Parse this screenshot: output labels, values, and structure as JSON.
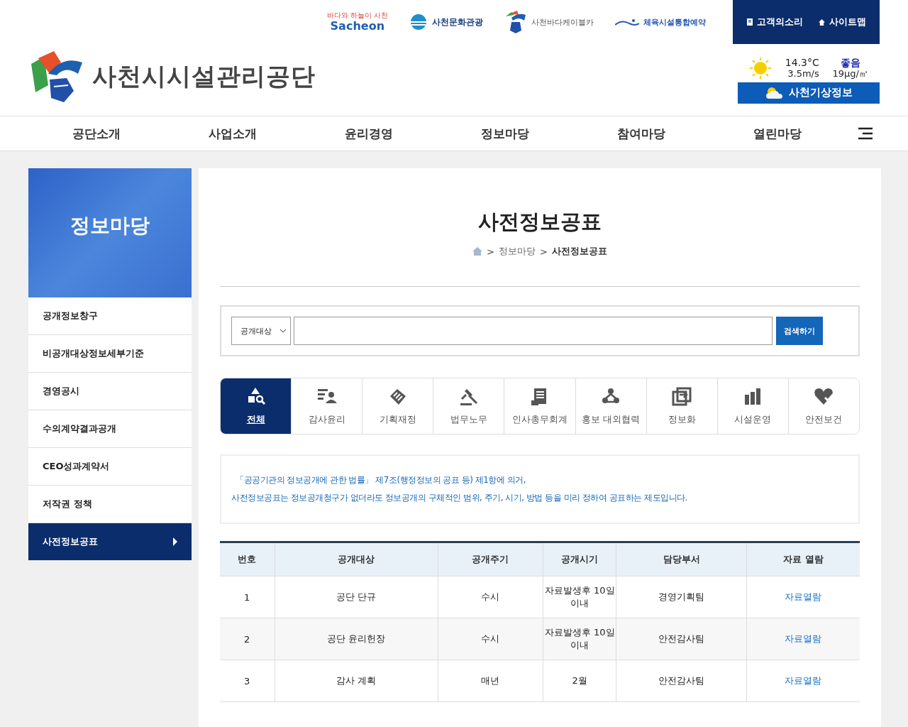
{
  "top_links": [
    {
      "kind": "sacheon",
      "label": "Sacheon",
      "tagline": "바다와 하늘이 사천"
    },
    {
      "kind": "culture",
      "label": "사천문화관광"
    },
    {
      "kind": "cable",
      "label": "사천바다케이블카"
    },
    {
      "kind": "sports",
      "label": "체육시설통합예약"
    }
  ],
  "util_links": [
    {
      "kind": "voice",
      "label": "고객의소리"
    },
    {
      "kind": "home",
      "label": "사이트맵"
    }
  ],
  "logo": {
    "text": "사천시시설관리공단"
  },
  "weather": {
    "temperature": "14.3°C",
    "wind": "3.5m/s",
    "air_status": "좋음",
    "pm": "19μg/㎥",
    "button": "사천기상정보"
  },
  "nav": [
    "공단소개",
    "사업소개",
    "윤리경영",
    "정보마당",
    "참여마당",
    "열린마당"
  ],
  "sidebar": {
    "title": "정보마당",
    "items": [
      {
        "label": "공개정보창구",
        "selected": false
      },
      {
        "label": "비공개대상정보세부기준",
        "selected": false
      },
      {
        "label": "경영공시",
        "selected": false
      },
      {
        "label": "수의계약결과공개",
        "selected": false
      },
      {
        "label": "CEO성과계약서",
        "selected": false
      },
      {
        "label": "저작권 정책",
        "selected": false
      },
      {
        "label": "사전정보공표",
        "selected": true
      }
    ]
  },
  "page_title": "사전정보공표",
  "breadcrumb": [
    "정보마당",
    "사전정보공표"
  ],
  "breadcrumb_separator": ">",
  "search": {
    "select_value": "공개대상",
    "button": "검색하기"
  },
  "categories": [
    {
      "kind": "all",
      "label": "전체",
      "selected": true
    },
    {
      "kind": "audit",
      "label": "감사윤리",
      "selected": false
    },
    {
      "kind": "finance",
      "label": "기획재정",
      "selected": false
    },
    {
      "kind": "law",
      "label": "법무노무",
      "selected": false
    },
    {
      "kind": "hr",
      "label": "인사총무회계",
      "selected": false
    },
    {
      "kind": "pr",
      "label": "홍보 대외협력",
      "selected": false
    },
    {
      "kind": "info",
      "label": "정보화",
      "selected": false
    },
    {
      "kind": "facility",
      "label": "시설운영",
      "selected": false
    },
    {
      "kind": "safety",
      "label": "안전보건",
      "selected": false
    }
  ],
  "notice": [
    "「공공기관의 정보공개에 관한 법률」 제7조(행정정보의 공표 등) 제1항에 의거,",
    "사전정보공표는 정보공개청구가 없더라도 정보공개의 구체적인 범위, 주기, 시기, 방법 등을 미리 정하여 공표하는 제도입니다."
  ],
  "table": {
    "columns": [
      "번호",
      "공개대상",
      "공개주기",
      "공개시기",
      "담당부서",
      "자료 열람"
    ],
    "rows": [
      [
        "1",
        "공단 단규",
        "수시",
        "자료발생후 10일 이내",
        "경영기획팀",
        "자료열람"
      ],
      [
        "2",
        "공단 윤리헌장",
        "수시",
        "자료발생후 10일 이내",
        "안전감사팀",
        "자료열람"
      ],
      [
        "3",
        "감사 계획",
        "매년",
        "2월",
        "안전감사팀",
        "자료열람"
      ]
    ]
  }
}
